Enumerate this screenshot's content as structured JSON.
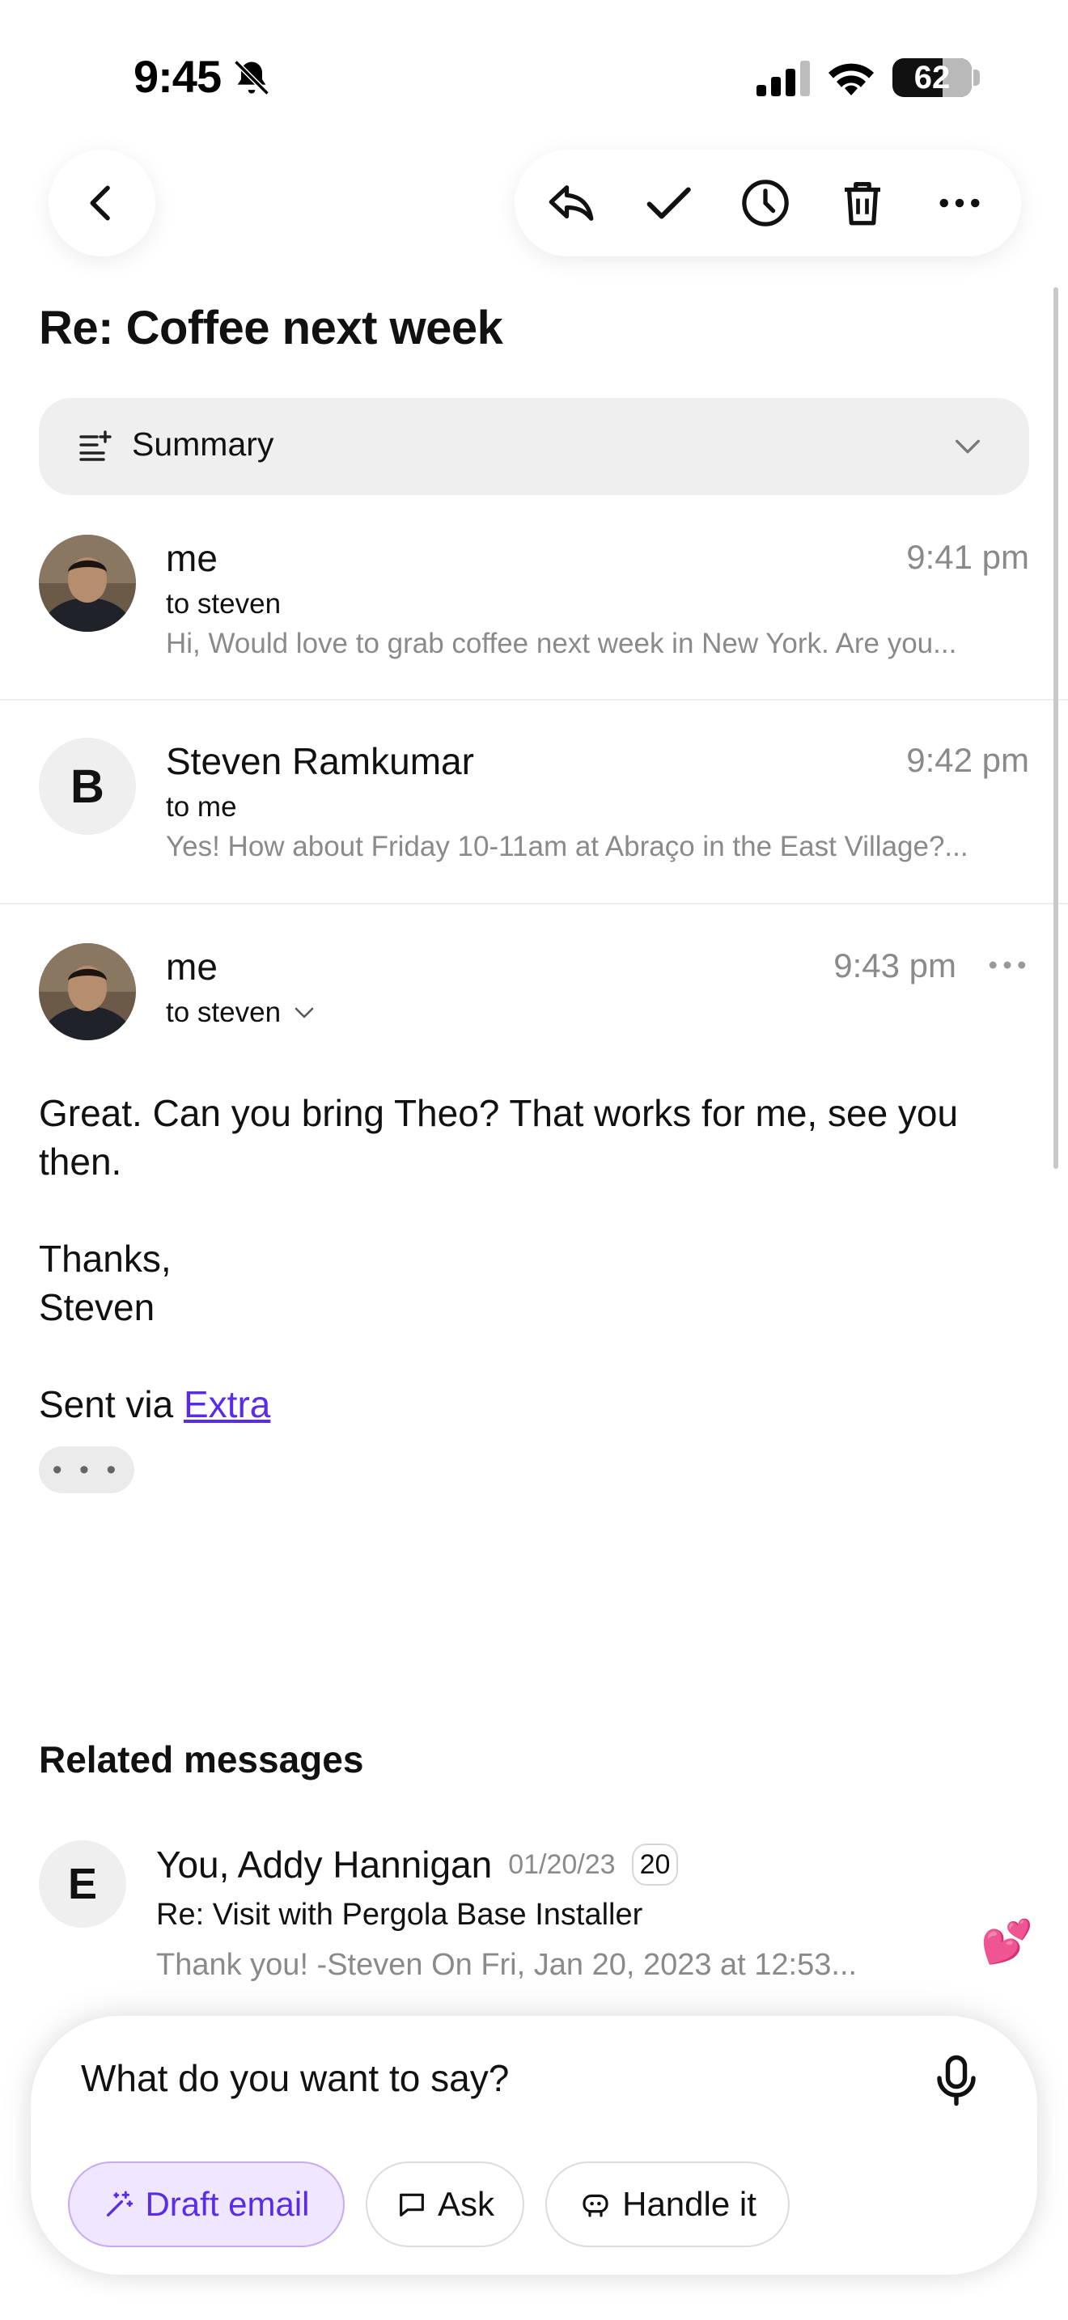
{
  "status": {
    "time": "9:45",
    "battery": "62"
  },
  "email": {
    "subject": "Re: Coffee next week",
    "summary_label": "Summary"
  },
  "messages": [
    {
      "sender": "me",
      "to": "to steven",
      "time": "9:41 pm",
      "snippet": "Hi, Would love to grab coffee next week in New York. Are you..."
    },
    {
      "sender": "Steven Ramkumar",
      "avatar_letter": "B",
      "to": "to me",
      "time": "9:42 pm",
      "snippet": "Yes! How about Friday 10-11am at Abraço in the East Village?..."
    },
    {
      "sender": "me",
      "to": "to steven",
      "time": "9:43 pm"
    }
  ],
  "open_message": {
    "line1": "Great. Can you bring Theo? That works for me, see you",
    "line2": "then.",
    "signoff": "Thanks,",
    "name": "Steven",
    "sent_via": "Sent via ",
    "sent_via_link": "Extra",
    "more": "• • •"
  },
  "related": {
    "title": "Related messages",
    "items": [
      {
        "avatar_letter": "E",
        "participants": "You, Addy Hannigan",
        "date": "01/20/23",
        "count": "20",
        "subject": "Re: Visit with Pergola Base Installer",
        "snippet": "Thank you! -Steven On Fri, Jan 20, 2023 at 12:53...",
        "reaction": "💕"
      }
    ]
  },
  "composer": {
    "placeholder": "What do you want to say?",
    "chips": {
      "draft": "Draft email",
      "ask": "Ask",
      "handle": "Handle it"
    }
  },
  "colors": {
    "accent": "#5a2be8",
    "chip_primary_bg": "#efe6ff"
  }
}
